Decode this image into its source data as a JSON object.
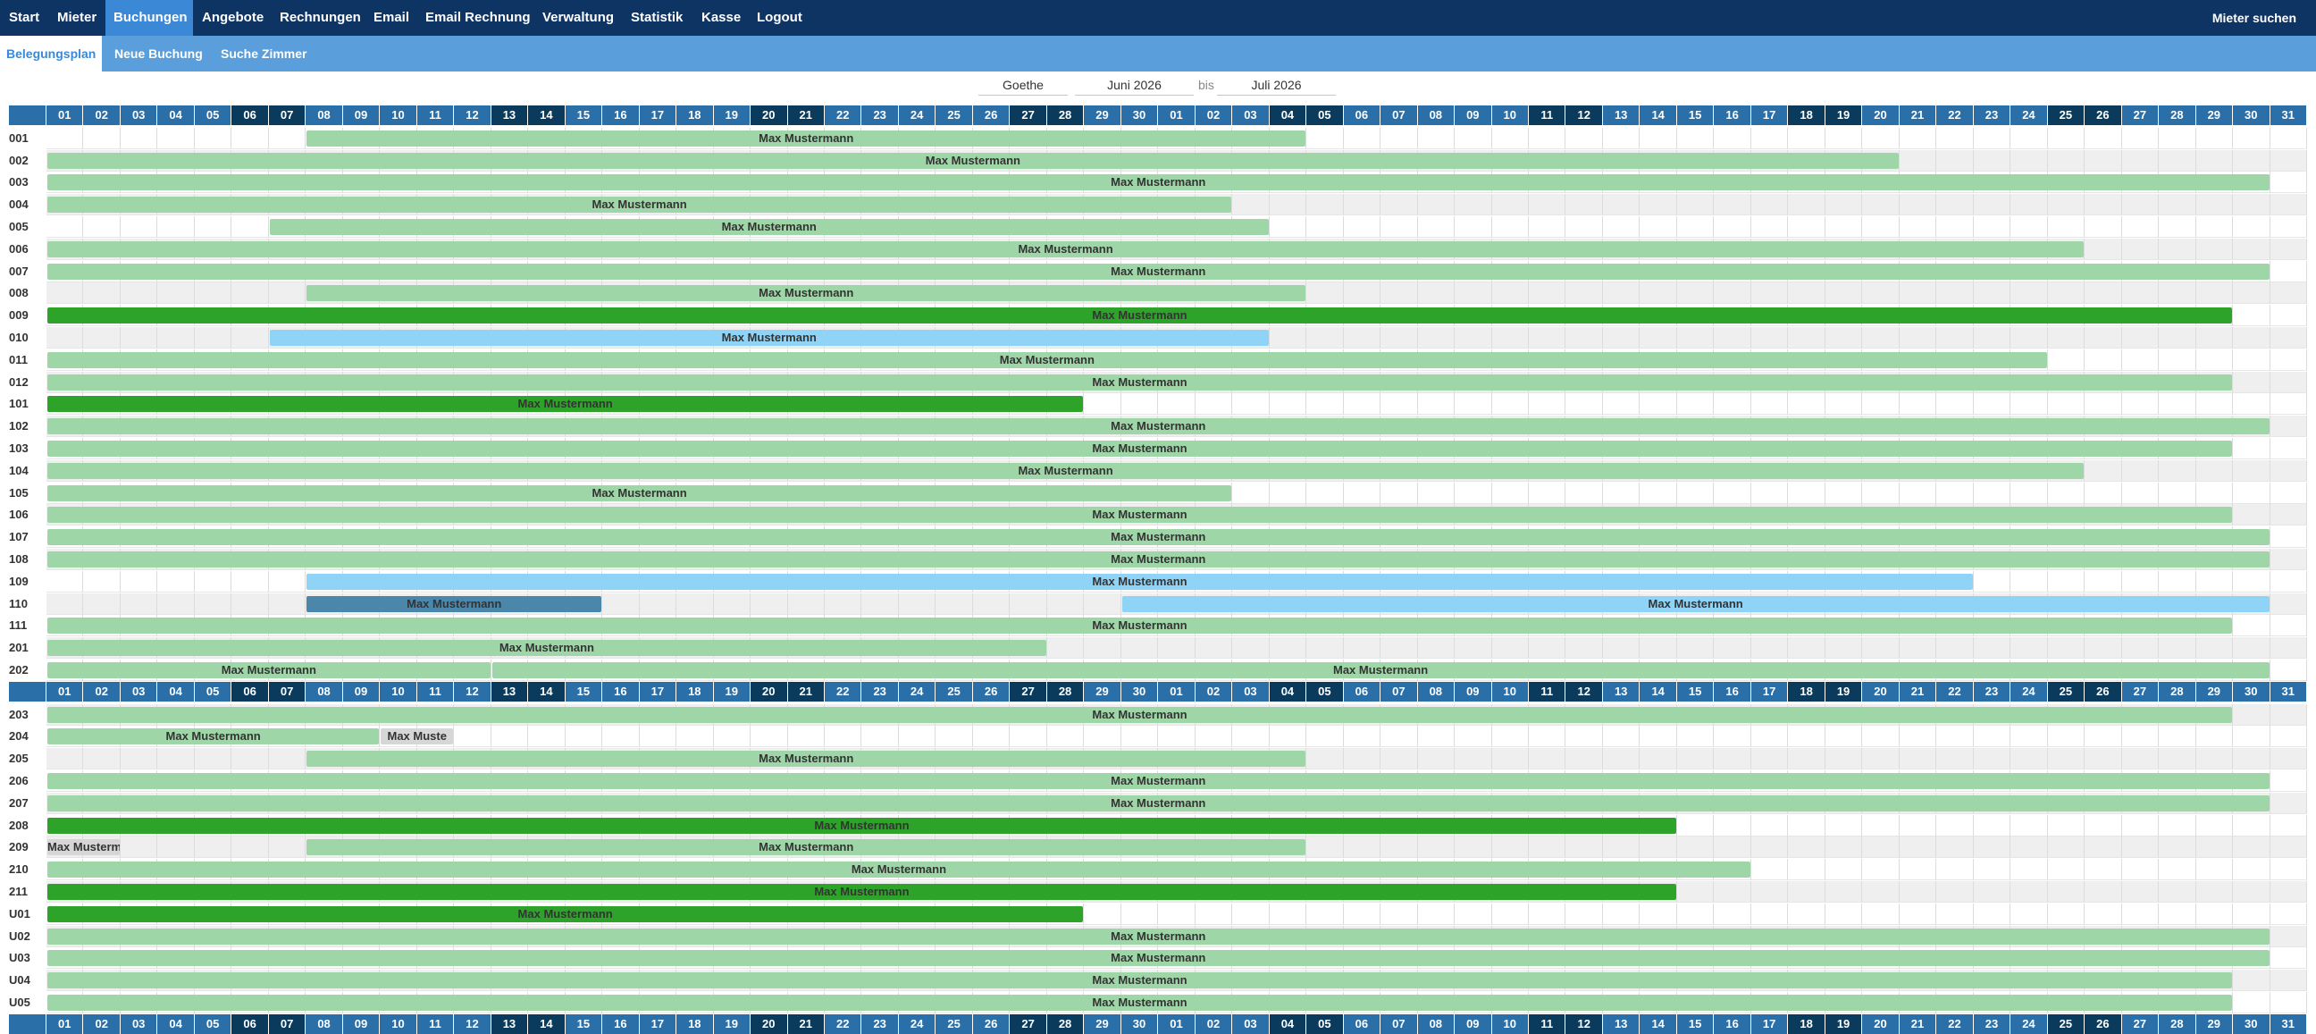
{
  "nav": {
    "items": [
      "Start",
      "Mieter",
      "Buchungen",
      "Angebote",
      "Rechnungen",
      "Email",
      "Email Rechnung",
      "Verwaltung",
      "Statistik",
      "Kasse",
      "Logout"
    ],
    "active_index": 2,
    "right_link": "Mieter suchen"
  },
  "subnav": {
    "items": [
      "Belegungsplan",
      "Neue Buchung",
      "Suche Zimmer"
    ],
    "active_index": 0
  },
  "filter": {
    "building": "Goethe",
    "from_month": "Juni 2026",
    "separator": "bis",
    "to_month": "Juli 2026"
  },
  "planner": {
    "days": [
      "01",
      "02",
      "03",
      "04",
      "05",
      "06",
      "07",
      "08",
      "09",
      "10",
      "11",
      "12",
      "13",
      "14",
      "15",
      "16",
      "17",
      "18",
      "19",
      "20",
      "21",
      "22",
      "23",
      "24",
      "25",
      "26",
      "27",
      "28",
      "29",
      "30",
      "01",
      "02",
      "03",
      "04",
      "05",
      "06",
      "07",
      "08",
      "09",
      "10",
      "11",
      "12",
      "13",
      "14",
      "15",
      "16",
      "17",
      "18",
      "19",
      "20",
      "21",
      "22",
      "23",
      "24",
      "25",
      "26",
      "27",
      "28",
      "29",
      "30",
      "31"
    ],
    "weekend_indices": [
      5,
      6,
      12,
      13,
      19,
      20,
      26,
      27,
      33,
      34,
      40,
      41,
      47,
      48,
      54,
      55
    ],
    "header_rows_before": [
      0,
      25
    ],
    "trailing_header": true,
    "colors": {
      "lightgreen": "#9fd6a8",
      "green": "#2ea32a",
      "lightblue": "#8fd3f7",
      "steel": "#4a87ab",
      "gray": "#d6d6d6",
      "header": "#2a6fa8",
      "header_weekend": "#0b3b5c"
    },
    "rooms": [
      {
        "room": "001",
        "bookings": [
          {
            "label": "Max Mustermann",
            "start": 7,
            "end": 34,
            "color": "lightgreen"
          }
        ]
      },
      {
        "room": "002",
        "bookings": [
          {
            "label": "Max Mustermann",
            "start": 0,
            "end": 50,
            "color": "lightgreen"
          }
        ]
      },
      {
        "room": "003",
        "bookings": [
          {
            "label": "Max Mustermann",
            "start": 0,
            "end": 60,
            "color": "lightgreen"
          }
        ]
      },
      {
        "room": "004",
        "bookings": [
          {
            "label": "Max Mustermann",
            "start": 0,
            "end": 32,
            "color": "lightgreen"
          }
        ]
      },
      {
        "room": "005",
        "bookings": [
          {
            "label": "Max Mustermann",
            "start": 6,
            "end": 33,
            "color": "lightgreen"
          }
        ]
      },
      {
        "room": "006",
        "bookings": [
          {
            "label": "Max Mustermann",
            "start": 0,
            "end": 55,
            "color": "lightgreen"
          }
        ]
      },
      {
        "room": "007",
        "bookings": [
          {
            "label": "Max Mustermann",
            "start": 0,
            "end": 60,
            "color": "lightgreen"
          }
        ]
      },
      {
        "room": "008",
        "bookings": [
          {
            "label": "Max Mustermann",
            "start": 7,
            "end": 34,
            "color": "lightgreen"
          }
        ]
      },
      {
        "room": "009",
        "bookings": [
          {
            "label": "Max Mustermann",
            "start": 0,
            "end": 59,
            "color": "green"
          }
        ]
      },
      {
        "room": "010",
        "bookings": [
          {
            "label": "Max Mustermann",
            "start": 6,
            "end": 33,
            "color": "lightblue"
          }
        ]
      },
      {
        "room": "011",
        "bookings": [
          {
            "label": "Max Mustermann",
            "start": 0,
            "end": 54,
            "color": "lightgreen"
          }
        ]
      },
      {
        "room": "012",
        "bookings": [
          {
            "label": "Max Mustermann",
            "start": 0,
            "end": 59,
            "color": "lightgreen"
          }
        ]
      },
      {
        "room": "101",
        "bookings": [
          {
            "label": "Max Mustermann",
            "start": 0,
            "end": 28,
            "color": "green"
          }
        ]
      },
      {
        "room": "102",
        "bookings": [
          {
            "label": "Max Mustermann",
            "start": 0,
            "end": 60,
            "color": "lightgreen"
          }
        ]
      },
      {
        "room": "103",
        "bookings": [
          {
            "label": "Max Mustermann",
            "start": 0,
            "end": 59,
            "color": "lightgreen"
          }
        ]
      },
      {
        "room": "104",
        "bookings": [
          {
            "label": "Max Mustermann",
            "start": 0,
            "end": 55,
            "color": "lightgreen"
          }
        ]
      },
      {
        "room": "105",
        "bookings": [
          {
            "label": "Max Mustermann",
            "start": 0,
            "end": 32,
            "color": "lightgreen"
          }
        ]
      },
      {
        "room": "106",
        "bookings": [
          {
            "label": "Max Mustermann",
            "start": 0,
            "end": 59,
            "color": "lightgreen"
          }
        ]
      },
      {
        "room": "107",
        "bookings": [
          {
            "label": "Max Mustermann",
            "start": 0,
            "end": 60,
            "color": "lightgreen"
          }
        ]
      },
      {
        "room": "108",
        "bookings": [
          {
            "label": "Max Mustermann",
            "start": 0,
            "end": 60,
            "color": "lightgreen"
          }
        ]
      },
      {
        "room": "109",
        "bookings": [
          {
            "label": "Max Mustermann",
            "start": 7,
            "end": 52,
            "color": "lightblue"
          }
        ]
      },
      {
        "room": "110",
        "bookings": [
          {
            "label": "Max Mustermann",
            "start": 7,
            "end": 15,
            "color": "steel"
          },
          {
            "label": "Max Mustermann",
            "start": 29,
            "end": 60,
            "color": "lightblue"
          }
        ]
      },
      {
        "room": "111",
        "bookings": [
          {
            "label": "Max Mustermann",
            "start": 0,
            "end": 59,
            "color": "lightgreen"
          }
        ]
      },
      {
        "room": "201",
        "bookings": [
          {
            "label": "Max Mustermann",
            "start": 0,
            "end": 27,
            "color": "lightgreen"
          }
        ]
      },
      {
        "room": "202",
        "bookings": [
          {
            "label": "Max Mustermann",
            "start": 0,
            "end": 12,
            "color": "lightgreen"
          },
          {
            "label": "Max Mustermann",
            "start": 12,
            "end": 60,
            "color": "lightgreen"
          }
        ]
      },
      {
        "room": "203",
        "bookings": [
          {
            "label": "Max Mustermann",
            "start": 0,
            "end": 59,
            "color": "lightgreen"
          }
        ]
      },
      {
        "room": "204",
        "bookings": [
          {
            "label": "Max Mustermann",
            "start": 0,
            "end": 9,
            "color": "lightgreen"
          },
          {
            "label": "Max Muste",
            "start": 9,
            "end": 11,
            "color": "gray"
          }
        ]
      },
      {
        "room": "205",
        "bookings": [
          {
            "label": "Max Mustermann",
            "start": 7,
            "end": 34,
            "color": "lightgreen"
          }
        ]
      },
      {
        "room": "206",
        "bookings": [
          {
            "label": "Max Mustermann",
            "start": 0,
            "end": 60,
            "color": "lightgreen"
          }
        ]
      },
      {
        "room": "207",
        "bookings": [
          {
            "label": "Max Mustermann",
            "start": 0,
            "end": 60,
            "color": "lightgreen"
          }
        ]
      },
      {
        "room": "208",
        "bookings": [
          {
            "label": "Max Mustermann",
            "start": 0,
            "end": 44,
            "color": "green"
          }
        ]
      },
      {
        "room": "209",
        "bookings": [
          {
            "label": "Max Musterm",
            "start": 0,
            "end": 2,
            "color": "gray"
          },
          {
            "label": "Max Mustermann",
            "start": 7,
            "end": 34,
            "color": "lightgreen"
          }
        ]
      },
      {
        "room": "210",
        "bookings": [
          {
            "label": "Max Mustermann",
            "start": 0,
            "end": 46,
            "color": "lightgreen"
          }
        ]
      },
      {
        "room": "211",
        "bookings": [
          {
            "label": "Max Mustermann",
            "start": 0,
            "end": 44,
            "color": "green"
          }
        ]
      },
      {
        "room": "U01",
        "bookings": [
          {
            "label": "Max Mustermann",
            "start": 0,
            "end": 28,
            "color": "green"
          }
        ]
      },
      {
        "room": "U02",
        "bookings": [
          {
            "label": "Max Mustermann",
            "start": 0,
            "end": 60,
            "color": "lightgreen"
          }
        ]
      },
      {
        "room": "U03",
        "bookings": [
          {
            "label": "Max Mustermann",
            "start": 0,
            "end": 60,
            "color": "lightgreen"
          }
        ]
      },
      {
        "room": "U04",
        "bookings": [
          {
            "label": "Max Mustermann",
            "start": 0,
            "end": 59,
            "color": "lightgreen"
          }
        ]
      },
      {
        "room": "U05",
        "bookings": [
          {
            "label": "Max Mustermann",
            "start": 0,
            "end": 59,
            "color": "lightgreen"
          }
        ]
      }
    ]
  }
}
